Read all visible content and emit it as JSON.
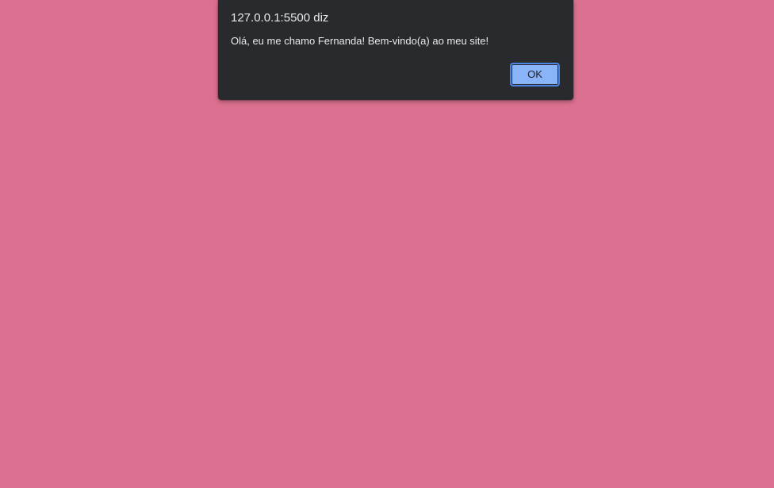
{
  "page": {
    "background_color": "#dc7090"
  },
  "alert": {
    "title": "127.0.0.1:5500 diz",
    "message": "Olá, eu me chamo Fernanda! Bem-vindo(a) ao meu site!",
    "ok_label": "OK",
    "dialog_color": "#292a2d",
    "button_color": "#8ab4f8"
  }
}
